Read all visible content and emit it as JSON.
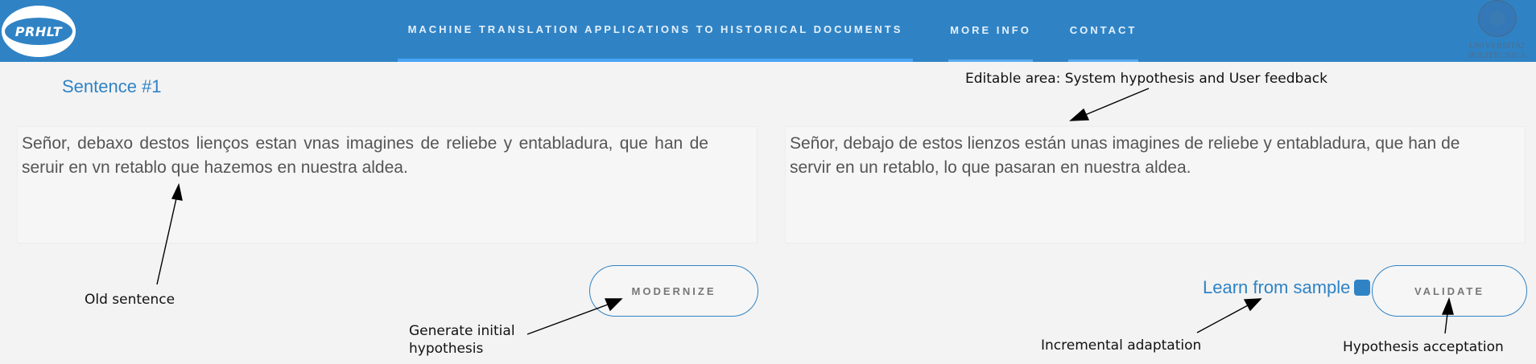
{
  "navbar": {
    "logo_text": "PRHLT",
    "items": [
      {
        "label": "MACHINE TRANSLATION APPLICATIONS TO HISTORICAL DOCUMENTS"
      },
      {
        "label": "MORE INFO"
      },
      {
        "label": "CONTACT"
      }
    ],
    "university": {
      "line1": "UNIVERSITAT",
      "line2": "POLITÈCNICA"
    }
  },
  "sentence": {
    "title": "Sentence #1",
    "original": "Señor, debaxo destos lienços estan vnas imagines de reliebe y entabladura, que han de seruir en vn retablo que hazemos en nuestra aldea.",
    "hypothesis": "Señor, debajo de estos lienzos están unas imagines de reliebe y entabladura, que han de servir en un retablo, lo que pasaran en nuestra aldea."
  },
  "buttons": {
    "modernize": "MODERNIZE",
    "validate": "VALIDATE"
  },
  "learn_label": "Learn from sample",
  "annotations": {
    "editable_area": "Editable area: System hypothesis and User feedback",
    "old_sentence": "Old sentence",
    "generate_line1": "Generate initial",
    "generate_line2": "hypothesis",
    "incremental": "Incremental adaptation",
    "acceptance": "Hypothesis acceptation"
  },
  "colors": {
    "brand": "#2f83c5",
    "nav_underline": "#48a4f4",
    "background": "#f3f3f3"
  }
}
